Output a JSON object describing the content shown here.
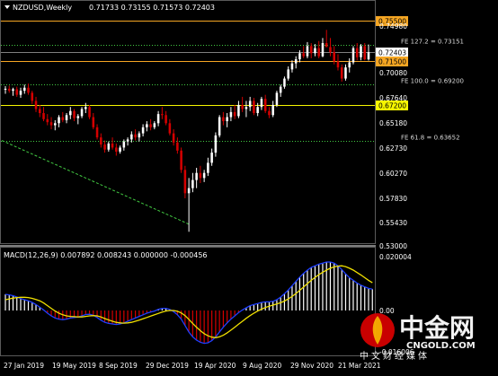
{
  "chart": {
    "symbol_label": "NZDUSD,Weekly",
    "ohlc_label": "0.71733 0.73155 0.71573 0.72403"
  },
  "macd": {
    "label": "MACD(12,26,9) 0.007892 0.008243 0.000000 -0.000456"
  },
  "price_axis": {
    "ticks": [
      "0.74980",
      "0.70080",
      "0.67640",
      "0.65180",
      "0.62730",
      "0.60270",
      "0.57830",
      "0.55430",
      "0.53000"
    ]
  },
  "macd_axis": {
    "ticks": [
      "0.020004",
      "0.00",
      "-0.016006"
    ]
  },
  "date_axis": {
    "labels": [
      "27 Jan 2019",
      "19 May 2019",
      "8 Sep 2019",
      "29 Dec 2019",
      "19 Apr 2020",
      "9 Aug 2020",
      "29 Nov 2020",
      "21 Mar 2021"
    ]
  },
  "levels": [
    {
      "price": 0.755,
      "badge": "0.75500",
      "style": "solid",
      "color": "#f5a623",
      "label": ""
    },
    {
      "price": 0.73151,
      "badge": "",
      "style": "dotted",
      "color": "#42c942",
      "label": "FE 127.2 = 0.73151"
    },
    {
      "price": 0.724,
      "badge": "0.72403",
      "style": "solid",
      "color": "#7f7f7f",
      "label": ""
    },
    {
      "price": 0.715,
      "badge": "0.71500",
      "style": "solid",
      "color": "#f5a623",
      "label": ""
    },
    {
      "price": 0.692,
      "badge": "",
      "style": "dotted",
      "color": "#42c942",
      "label": "FE 100.0 = 0.69200"
    },
    {
      "price": 0.672,
      "badge": "0.67200",
      "style": "solid",
      "color": "#f5f500",
      "label": ""
    },
    {
      "price": 0.63652,
      "badge": "",
      "style": "dotted",
      "color": "#42c942",
      "label": "FE 61.8 = 0.63652"
    }
  ],
  "trendline": {
    "start_price": 0.637,
    "end_price": 0.5545,
    "color": "#42c942"
  },
  "colors": {
    "bull": "#ffffff",
    "bear": "#d40000",
    "level_orange": "#f5a623",
    "level_yellow": "#f5f500",
    "fib_green": "#42c942",
    "macd_line": "#1f3fff",
    "signal_line": "#f0e000",
    "hist_pos": "#ffffff",
    "hist_neg": "#d40000",
    "watermark": "#d40000"
  },
  "candles": [
    [
      0.687,
      0.6905,
      0.683,
      0.688
    ],
    [
      0.688,
      0.691,
      0.684,
      0.686
    ],
    [
      0.686,
      0.689,
      0.681,
      0.6875
    ],
    [
      0.6875,
      0.69,
      0.68,
      0.682
    ],
    [
      0.682,
      0.689,
      0.679,
      0.686
    ],
    [
      0.686,
      0.692,
      0.683,
      0.689
    ],
    [
      0.689,
      0.693,
      0.682,
      0.684
    ],
    [
      0.684,
      0.686,
      0.673,
      0.676
    ],
    [
      0.676,
      0.68,
      0.665,
      0.668
    ],
    [
      0.668,
      0.672,
      0.66,
      0.664
    ],
    [
      0.664,
      0.67,
      0.656,
      0.658
    ],
    [
      0.658,
      0.663,
      0.652,
      0.655
    ],
    [
      0.655,
      0.66,
      0.648,
      0.652
    ],
    [
      0.652,
      0.657,
      0.647,
      0.654
    ],
    [
      0.654,
      0.662,
      0.65,
      0.66
    ],
    [
      0.66,
      0.665,
      0.655,
      0.657
    ],
    [
      0.657,
      0.664,
      0.654,
      0.662
    ],
    [
      0.662,
      0.67,
      0.658,
      0.666
    ],
    [
      0.666,
      0.668,
      0.656,
      0.659
    ],
    [
      0.659,
      0.663,
      0.653,
      0.661
    ],
    [
      0.661,
      0.67,
      0.659,
      0.668
    ],
    [
      0.668,
      0.674,
      0.664,
      0.67
    ],
    [
      0.67,
      0.672,
      0.658,
      0.66
    ],
    [
      0.66,
      0.664,
      0.648,
      0.65
    ],
    [
      0.65,
      0.653,
      0.638,
      0.64
    ],
    [
      0.64,
      0.644,
      0.63,
      0.633
    ],
    [
      0.633,
      0.637,
      0.625,
      0.628
    ],
    [
      0.628,
      0.636,
      0.626,
      0.634
    ],
    [
      0.634,
      0.64,
      0.628,
      0.63
    ],
    [
      0.63,
      0.634,
      0.622,
      0.626
    ],
    [
      0.626,
      0.632,
      0.624,
      0.63
    ],
    [
      0.63,
      0.638,
      0.627,
      0.636
    ],
    [
      0.636,
      0.64,
      0.632,
      0.638
    ],
    [
      0.638,
      0.646,
      0.635,
      0.643
    ],
    [
      0.643,
      0.648,
      0.637,
      0.64
    ],
    [
      0.64,
      0.646,
      0.636,
      0.644
    ],
    [
      0.644,
      0.653,
      0.641,
      0.65
    ],
    [
      0.65,
      0.656,
      0.646,
      0.653
    ],
    [
      0.653,
      0.658,
      0.647,
      0.65
    ],
    [
      0.65,
      0.656,
      0.648,
      0.654
    ],
    [
      0.654,
      0.666,
      0.651,
      0.663
    ],
    [
      0.663,
      0.67,
      0.658,
      0.662
    ],
    [
      0.662,
      0.666,
      0.652,
      0.654
    ],
    [
      0.654,
      0.658,
      0.642,
      0.644
    ],
    [
      0.644,
      0.648,
      0.632,
      0.635
    ],
    [
      0.635,
      0.64,
      0.624,
      0.627
    ],
    [
      0.627,
      0.63,
      0.605,
      0.608
    ],
    [
      0.608,
      0.612,
      0.58,
      0.585
    ],
    [
      0.585,
      0.6,
      0.547,
      0.59
    ],
    [
      0.59,
      0.605,
      0.586,
      0.598
    ],
    [
      0.598,
      0.61,
      0.59,
      0.605
    ],
    [
      0.605,
      0.612,
      0.595,
      0.6
    ],
    [
      0.6,
      0.608,
      0.596,
      0.605
    ],
    [
      0.605,
      0.62,
      0.602,
      0.615
    ],
    [
      0.615,
      0.629,
      0.612,
      0.625
    ],
    [
      0.625,
      0.645,
      0.621,
      0.642
    ],
    [
      0.642,
      0.662,
      0.64,
      0.66
    ],
    [
      0.66,
      0.665,
      0.652,
      0.656
    ],
    [
      0.656,
      0.664,
      0.65,
      0.66
    ],
    [
      0.66,
      0.67,
      0.656,
      0.665
    ],
    [
      0.665,
      0.672,
      0.658,
      0.661
    ],
    [
      0.661,
      0.676,
      0.659,
      0.672
    ],
    [
      0.672,
      0.68,
      0.665,
      0.668
    ],
    [
      0.668,
      0.676,
      0.66,
      0.67
    ],
    [
      0.67,
      0.68,
      0.666,
      0.676
    ],
    [
      0.676,
      0.679,
      0.662,
      0.664
    ],
    [
      0.664,
      0.674,
      0.661,
      0.67
    ],
    [
      0.67,
      0.68,
      0.667,
      0.678
    ],
    [
      0.678,
      0.682,
      0.664,
      0.666
    ],
    [
      0.666,
      0.67,
      0.659,
      0.662
    ],
    [
      0.662,
      0.676,
      0.66,
      0.672
    ],
    [
      0.672,
      0.686,
      0.67,
      0.684
    ],
    [
      0.684,
      0.692,
      0.68,
      0.69
    ],
    [
      0.69,
      0.7,
      0.688,
      0.698
    ],
    [
      0.698,
      0.71,
      0.696,
      0.707
    ],
    [
      0.707,
      0.716,
      0.704,
      0.713
    ],
    [
      0.713,
      0.72,
      0.708,
      0.717
    ],
    [
      0.717,
      0.726,
      0.714,
      0.723
    ],
    [
      0.723,
      0.73,
      0.718,
      0.72
    ],
    [
      0.72,
      0.734,
      0.718,
      0.73
    ],
    [
      0.73,
      0.733,
      0.718,
      0.723
    ],
    [
      0.723,
      0.732,
      0.72,
      0.728
    ],
    [
      0.728,
      0.735,
      0.718,
      0.72
    ],
    [
      0.72,
      0.738,
      0.719,
      0.733
    ],
    [
      0.733,
      0.746,
      0.73,
      0.729
    ],
    [
      0.729,
      0.738,
      0.72,
      0.724
    ],
    [
      0.724,
      0.73,
      0.712,
      0.715
    ],
    [
      0.715,
      0.722,
      0.706,
      0.709
    ],
    [
      0.709,
      0.712,
      0.695,
      0.698
    ],
    [
      0.698,
      0.712,
      0.696,
      0.709
    ],
    [
      0.709,
      0.718,
      0.704,
      0.714
    ],
    [
      0.714,
      0.73,
      0.712,
      0.728
    ],
    [
      0.728,
      0.733,
      0.716,
      0.719
    ],
    [
      0.719,
      0.732,
      0.716,
      0.73
    ],
    [
      0.73,
      0.733,
      0.716,
      0.717
    ],
    [
      0.717,
      0.7316,
      0.7157,
      0.724
    ]
  ],
  "macd_series": {
    "macd": [
      0.006,
      0.0058,
      0.0055,
      0.005,
      0.0044,
      0.004,
      0.0036,
      0.003,
      0.0022,
      0.0012,
      0.0002,
      -0.001,
      -0.002,
      -0.0028,
      -0.0032,
      -0.0034,
      -0.0032,
      -0.0028,
      -0.0026,
      -0.0024,
      -0.002,
      -0.0015,
      -0.0014,
      -0.0018,
      -0.0026,
      -0.0036,
      -0.0044,
      -0.0048,
      -0.005,
      -0.0052,
      -0.005,
      -0.0046,
      -0.004,
      -0.0034,
      -0.0028,
      -0.0022,
      -0.0016,
      -0.001,
      -0.0006,
      -0.0002,
      0.0004,
      0.0008,
      0.0008,
      0.0004,
      -0.0004,
      -0.0016,
      -0.0032,
      -0.0056,
      -0.008,
      -0.0098,
      -0.011,
      -0.0118,
      -0.0122,
      -0.012,
      -0.0112,
      -0.0098,
      -0.008,
      -0.0062,
      -0.0046,
      -0.0032,
      -0.002,
      -0.0008,
      0.0002,
      0.001,
      0.0018,
      0.0022,
      0.0026,
      0.003,
      0.0032,
      0.0032,
      0.0034,
      0.004,
      0.005,
      0.0062,
      0.0076,
      0.0092,
      0.0108,
      0.0124,
      0.0138,
      0.015,
      0.016,
      0.0166,
      0.0172,
      0.0176,
      0.018,
      0.018,
      0.0176,
      0.0166,
      0.0152,
      0.0136,
      0.0122,
      0.0112,
      0.0102,
      0.0094,
      0.0088,
      0.0082,
      0.0079
    ],
    "signal": [
      0.004,
      0.0043,
      0.0046,
      0.0048,
      0.0049,
      0.0049,
      0.0048,
      0.0045,
      0.0041,
      0.0036,
      0.0028,
      0.0018,
      0.0008,
      -0.0002,
      -0.001,
      -0.0016,
      -0.002,
      -0.0022,
      -0.0023,
      -0.0024,
      -0.0024,
      -0.0022,
      -0.002,
      -0.0019,
      -0.002,
      -0.0024,
      -0.003,
      -0.0035,
      -0.004,
      -0.0044,
      -0.0046,
      -0.0047,
      -0.0046,
      -0.0044,
      -0.004,
      -0.0036,
      -0.0031,
      -0.0026,
      -0.0021,
      -0.0016,
      -0.0011,
      -0.0006,
      -0.0002,
      0.0,
      0.0,
      -0.0003,
      -0.0009,
      -0.0019,
      -0.0033,
      -0.0048,
      -0.0062,
      -0.0075,
      -0.0086,
      -0.0094,
      -0.0099,
      -0.0101,
      -0.0098,
      -0.0092,
      -0.0083,
      -0.0073,
      -0.0062,
      -0.0051,
      -0.004,
      -0.0029,
      -0.0019,
      -0.001,
      -0.0002,
      0.0005,
      0.0011,
      0.0016,
      0.002,
      0.0024,
      0.0029,
      0.0035,
      0.0043,
      0.0052,
      0.0063,
      0.0075,
      0.0087,
      0.01,
      0.0112,
      0.0123,
      0.0133,
      0.0142,
      0.015,
      0.0157,
      0.0162,
      0.0165,
      0.0166,
      0.0163,
      0.0157,
      0.015,
      0.0141,
      0.0132,
      0.0122,
      0.0112,
      0.0103
    ]
  },
  "watermark": {
    "brand_cn": "中金网",
    "site": "CNGOLD.COM",
    "slogan_cn": "中文财经媒体"
  }
}
